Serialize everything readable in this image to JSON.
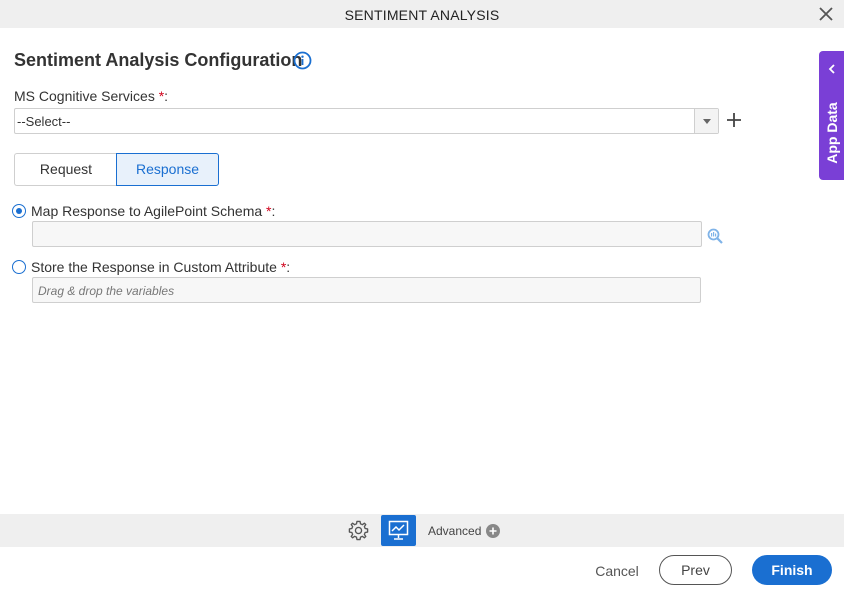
{
  "window": {
    "title": "SENTIMENT ANALYSIS"
  },
  "page": {
    "heading": "Sentiment Analysis Configuration"
  },
  "form": {
    "required_mark": "*",
    "colon": ":",
    "cognitive_services": {
      "label": "MS Cognitive Services ",
      "selected": "--Select--"
    },
    "tabs": [
      {
        "label": "Request",
        "active": false
      },
      {
        "label": "Response",
        "active": true
      }
    ],
    "map_response": {
      "label": "Map Response to AgilePoint Schema ",
      "checked": true,
      "value": ""
    },
    "store_response": {
      "label": "Store the Response in Custom Attribute ",
      "checked": false,
      "placeholder": "Drag & drop the variables"
    }
  },
  "side_panel": {
    "label": "App Data"
  },
  "toolbar": {
    "advanced_label": "Advanced"
  },
  "footer": {
    "cancel": "Cancel",
    "prev": "Prev",
    "finish": "Finish"
  },
  "colors": {
    "accent": "#1a6fd1",
    "app_data": "#7a3fd6",
    "required": "#d0021b"
  }
}
